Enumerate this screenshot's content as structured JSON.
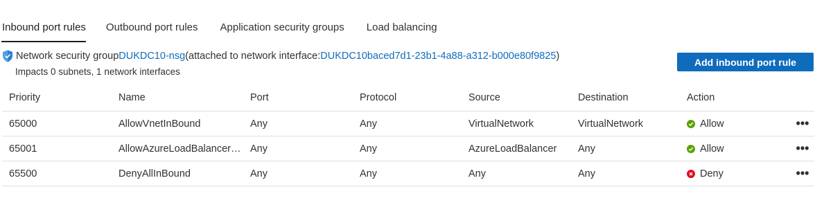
{
  "tabs": [
    {
      "label": "Inbound port rules"
    },
    {
      "label": "Outbound port rules"
    },
    {
      "label": "Application security groups"
    },
    {
      "label": "Load balancing"
    }
  ],
  "nsg": {
    "prefix": "Network security group ",
    "name": "DUKDC10-nsg",
    "middle": " (attached to network interface: ",
    "nic": "DUKDC10baced7d1-23b1-4a88-a312-b000e80f9825",
    "suffix": ")",
    "impacts": "Impacts 0 subnets, 1 network interfaces"
  },
  "add_button": "Add inbound port rule",
  "columns": [
    "Priority",
    "Name",
    "Port",
    "Protocol",
    "Source",
    "Destination",
    "Action"
  ],
  "rules": [
    {
      "priority": "65000",
      "name": "AllowVnetInBound",
      "port": "Any",
      "protocol": "Any",
      "source": "VirtualNetwork",
      "destination": "VirtualNetwork",
      "action": "Allow",
      "action_color": "#57a300"
    },
    {
      "priority": "65001",
      "name": "AllowAzureLoadBalancerInBound",
      "port": "Any",
      "protocol": "Any",
      "source": "AzureLoadBalancer",
      "destination": "Any",
      "action": "Allow",
      "action_color": "#57a300"
    },
    {
      "priority": "65500",
      "name": "DenyAllInBound",
      "port": "Any",
      "protocol": "Any",
      "source": "Any",
      "destination": "Any",
      "action": "Deny",
      "action_color": "#e00b1c"
    }
  ],
  "more_glyph": "•••",
  "icons": {
    "shield": "shield-icon",
    "allow": "check-circle-icon",
    "deny": "error-circle-icon"
  }
}
